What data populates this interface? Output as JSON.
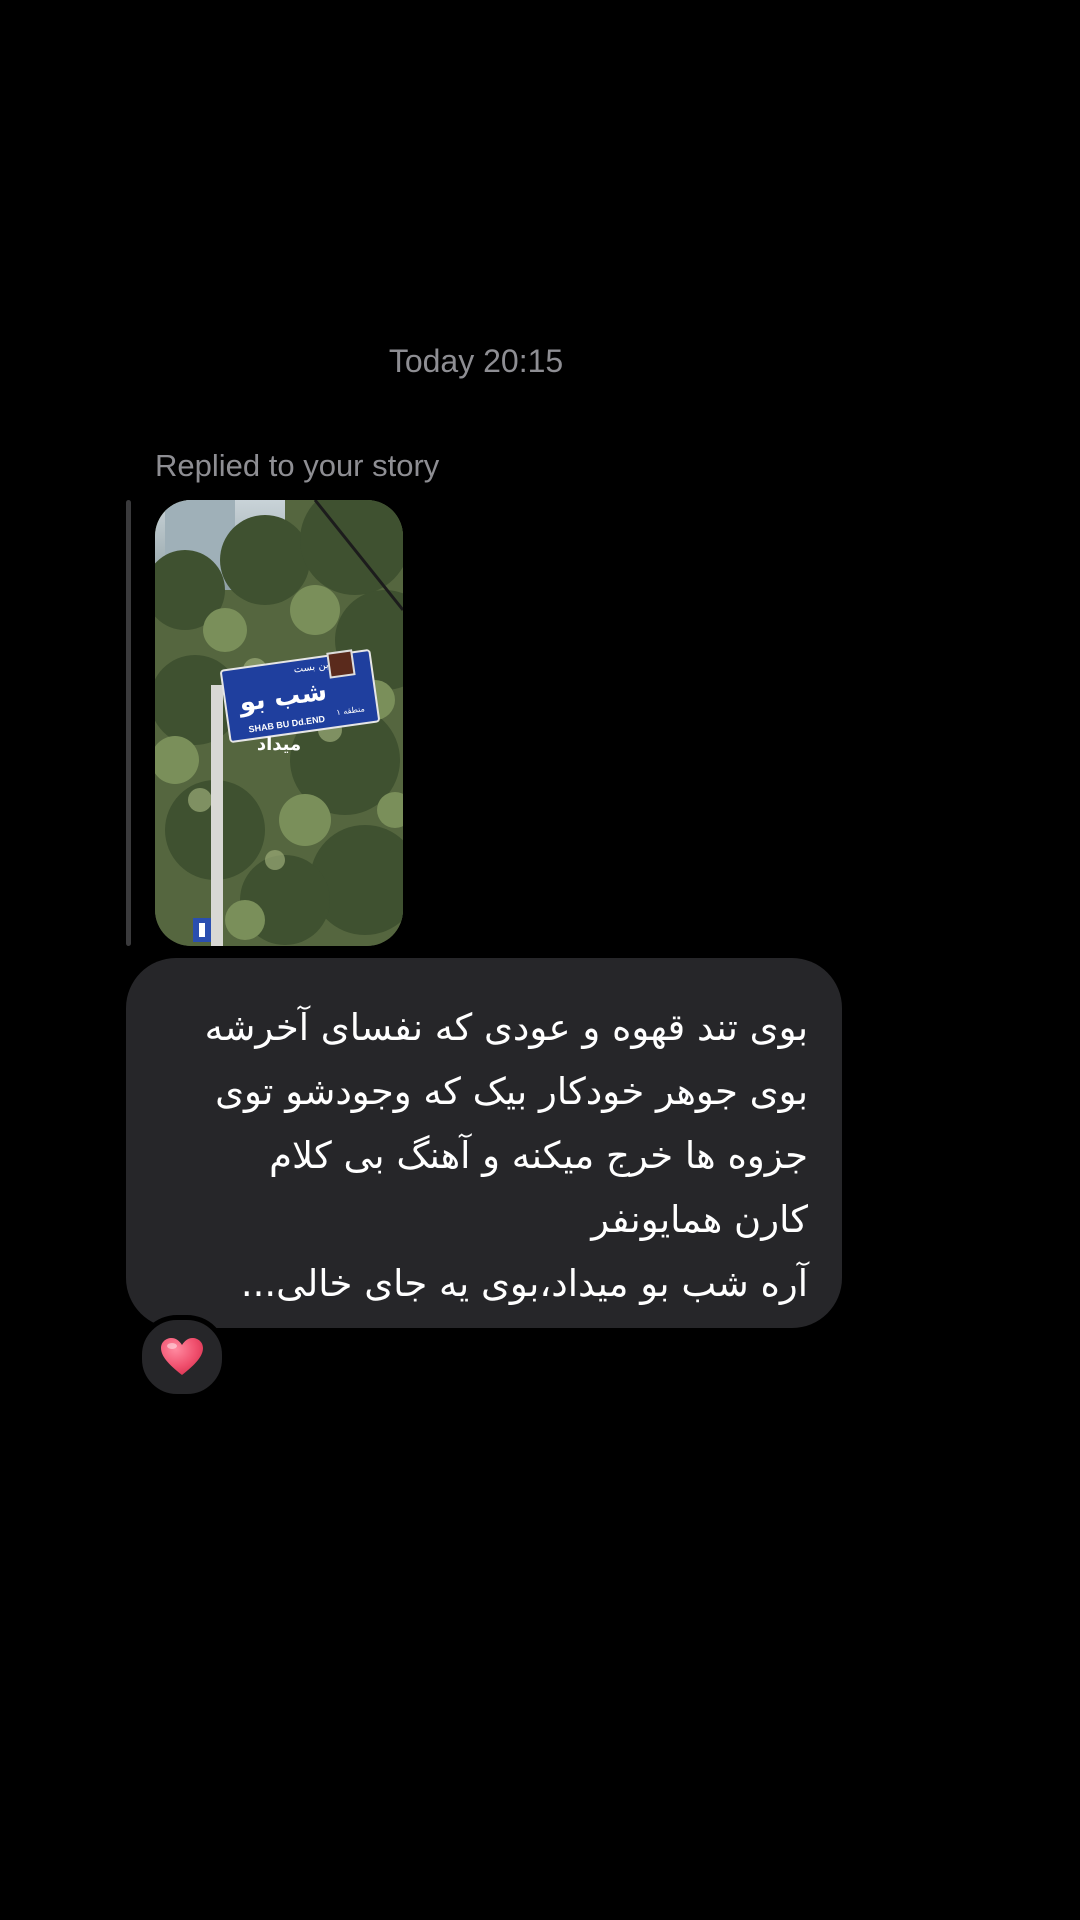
{
  "conversation": {
    "timestamp": "Today 20:15",
    "reply_context": {
      "label": "Replied to your story",
      "story_thumbnail": {
        "sign_text_fa": "شب بو",
        "sign_text_en": "SHAB BU Dd.END",
        "sign_small_fa": "بن بست",
        "sign_district": "منطقه ۱",
        "sign_below_fa": "میداد"
      }
    },
    "message": {
      "direction": "rtl",
      "lines": [
        "بوی تند قهوه و عودی که نفسای آخرشه",
        "بوی جوهر خودکار بیک که وجودشو توی",
        "جزوه ها خرج میکنه و آهنگ بی کلام",
        "کارن همایونفر",
        "آره شب بو میداد،بوی یه جای خالی..."
      ]
    },
    "reaction": {
      "icon": "heart-icon",
      "color": "#f0506e"
    }
  },
  "colors": {
    "background": "#000000",
    "bubble": "#262629",
    "secondary_text": "#8e8e93",
    "reply_bar": "#3a3a3c"
  }
}
